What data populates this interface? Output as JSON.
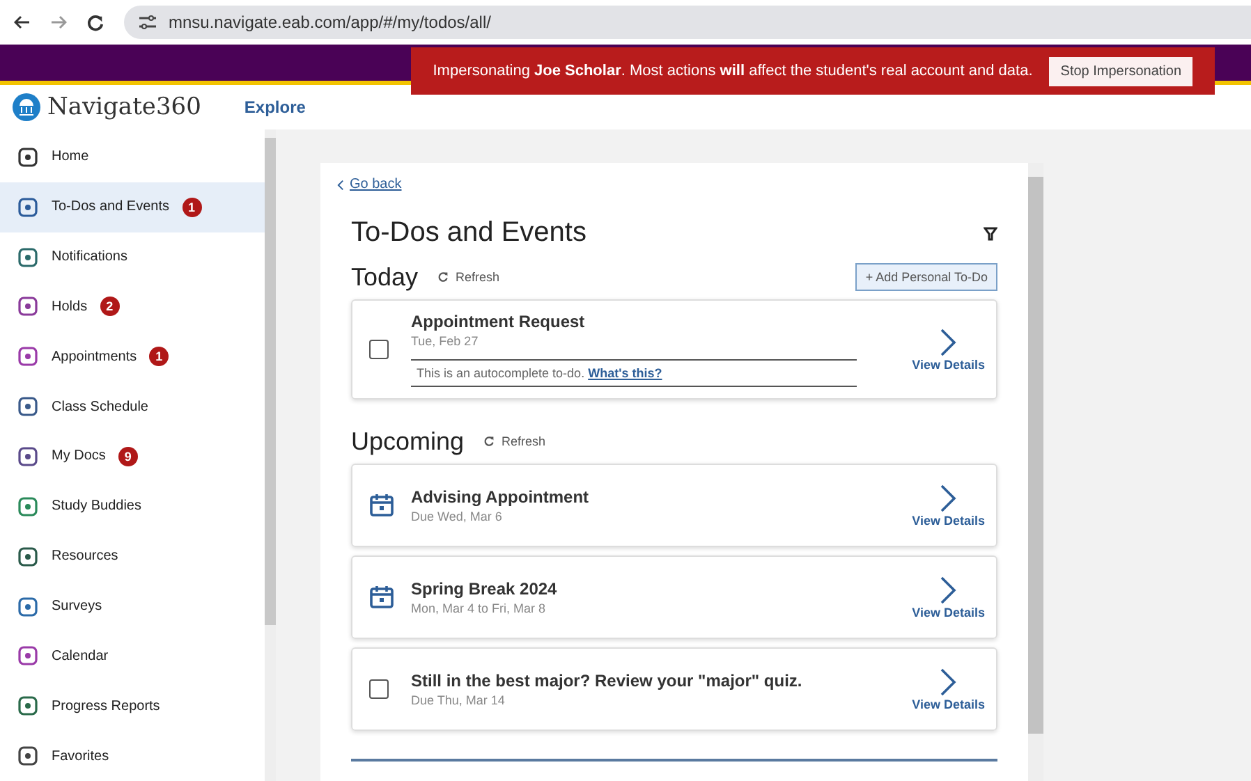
{
  "browser": {
    "url": "mnsu.navigate.eab.com/app/#/my/todos/all/"
  },
  "banner": {
    "text": "Impersonating **Joe Scholar**. Most actions **will** affect the student's real account and data.",
    "button": "Stop Impersonation"
  },
  "header": {
    "logo": "Navigate360",
    "nav": "Explore"
  },
  "sidebar": {
    "items": [
      {
        "label": "Home",
        "selected": false
      },
      {
        "label": "To-Dos and Events",
        "selected": true,
        "badge": "1"
      },
      {
        "label": "Notifications",
        "selected": false
      },
      {
        "label": "Holds",
        "selected": false,
        "badge": "2"
      },
      {
        "label": "Appointments",
        "selected": false,
        "badge": "1"
      },
      {
        "label": "Class Schedule",
        "selected": false
      },
      {
        "label": "My Docs",
        "selected": false,
        "badge": "9"
      },
      {
        "label": "Study Buddies",
        "selected": false
      },
      {
        "label": "Resources",
        "selected": false
      },
      {
        "label": "Surveys",
        "selected": false
      },
      {
        "label": "Calendar",
        "selected": false
      },
      {
        "label": "Progress Reports",
        "selected": false
      },
      {
        "label": "Favorites",
        "selected": false
      }
    ]
  },
  "page": {
    "back": "Go back",
    "title": "To-Dos and Events",
    "today": {
      "heading": "Today",
      "refresh": "Refresh",
      "add": "+ Add Personal To-Do",
      "items": [
        {
          "kind": "checkbox",
          "checked": false,
          "title": "Appointment Request",
          "date": "Tue, Feb 27",
          "note": "This is an autocomplete to-do.",
          "note_link": "What's this?",
          "action": "View Details"
        }
      ]
    },
    "upcoming": {
      "heading": "Upcoming",
      "refresh": "Refresh",
      "items": [
        {
          "kind": "event",
          "title": "Advising Appointment",
          "date": "Due Wed, Mar 6",
          "action": "View Details"
        },
        {
          "kind": "event",
          "title": "Spring Break 2024",
          "date": "Mon, Mar 4 to Fri, Mar 8",
          "action": "View Details"
        },
        {
          "kind": "checkbox",
          "checked": false,
          "title": "Still in the best major? Review your \"major\" quiz.",
          "date": "Due Thu, Mar 14",
          "action": "View Details"
        }
      ]
    }
  }
}
